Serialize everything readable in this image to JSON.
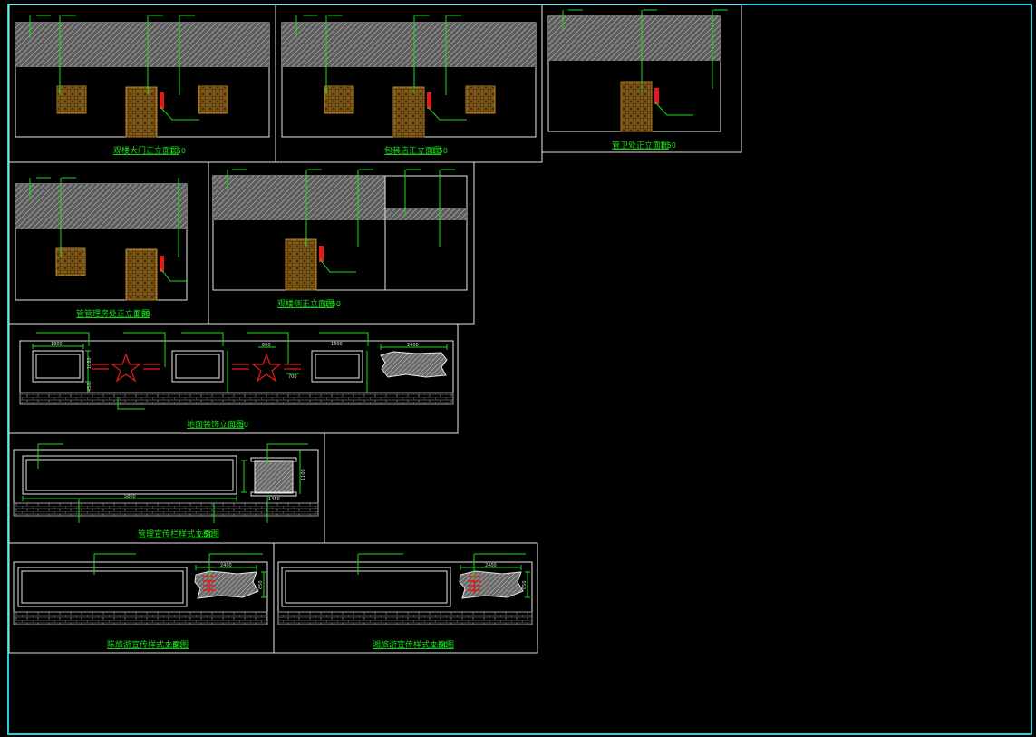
{
  "colors": {
    "background": "#000000",
    "sheet_border": "#22d3e0",
    "frame": "#e6e6e6",
    "leader": "#1ed81e",
    "title": "#19e019",
    "note": "#d8d8d8",
    "dimension": "#1ed81e",
    "door_wood": "#9a6a1e",
    "accent_red": "#e51b1b",
    "hatch": "#9b9b9b"
  },
  "panels": {
    "p1": {
      "title": "观楼大门正立面图",
      "scale": "1:50"
    },
    "p2": {
      "title": "包装店正立面图",
      "scale": "1:50"
    },
    "p3": {
      "title": "管卫处正立面图",
      "scale": "1:50"
    },
    "p4": {
      "title": "管管理房处正立面图",
      "scale": "1:50"
    },
    "p5": {
      "title": "观楼侧正立面图",
      "scale": "1:50"
    },
    "p6": {
      "title": "地面装饰立面图",
      "scale": "1:50"
    },
    "p7": {
      "title": "管理宣传栏样式立面图",
      "scale": "1:50"
    },
    "p8": {
      "title": "陈旅游宣传样式立面图",
      "scale": "1:50"
    },
    "p9": {
      "title": "湘旅游宣传样式立面图",
      "scale": "1:50"
    }
  },
  "dims": {
    "p6_window": "1800",
    "p6_height": "1080",
    "p6_base": "450",
    "p6_star": "600",
    "p6_side": "700",
    "p6_stone": "2400",
    "p7_length": "5800",
    "p7_height": "1100",
    "p7_base": "1450",
    "p7_post": "1800",
    "p8_stone": "2400",
    "p8_height": "650",
    "p9_stone": "2400",
    "p9_height": "650"
  }
}
